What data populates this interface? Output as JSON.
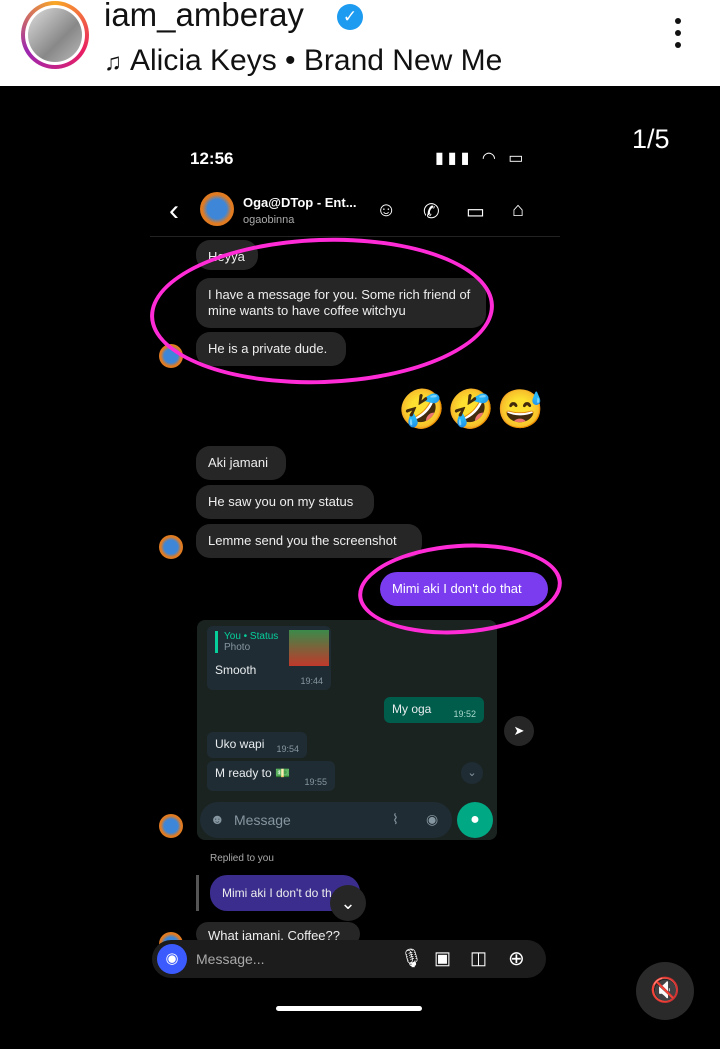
{
  "post": {
    "username": "iam_amberay",
    "verified_icon": "verified-badge-icon",
    "music": "Alicia Keys • Brand New Me",
    "counter": "1/5"
  },
  "phone": {
    "time": "12:56",
    "status_icons": "signal, wifi, battery",
    "contact_name": "Oga@DTop - Ent...",
    "contact_handle": "ogaobinna"
  },
  "messages": [
    {
      "text": "Heyya"
    },
    {
      "text": "I have a message for you. Some rich friend of mine wants to have coffee witchyu"
    },
    {
      "text": "He is a private dude."
    },
    {
      "text": "🤣🤣😅"
    },
    {
      "text": "Aki jamani"
    },
    {
      "text": "He saw you on my status"
    },
    {
      "text": "Lemme send you the screenshot"
    },
    {
      "text": "Mimi aki I don't do that"
    }
  ],
  "whatsapp": {
    "status_reply_label": "You • Status",
    "photo_label": "Photo",
    "smooth": "Smooth",
    "smooth_time": "19:44",
    "my_oga": "My oga",
    "my_oga_time": "19:52",
    "uko_wapi": "Uko wapi",
    "uko_time": "19:54",
    "ready": "M ready to 💵",
    "ready_time": "19:55",
    "placeholder": "Message"
  },
  "replied_label": "Replied to you",
  "replied_text": "Mimi aki I don't do th",
  "last_msg": "What jamani. Coffee??",
  "input_placeholder": "Message...",
  "colors": {
    "accent": "#7b3cf0",
    "highlight": "#ff2bd6"
  }
}
